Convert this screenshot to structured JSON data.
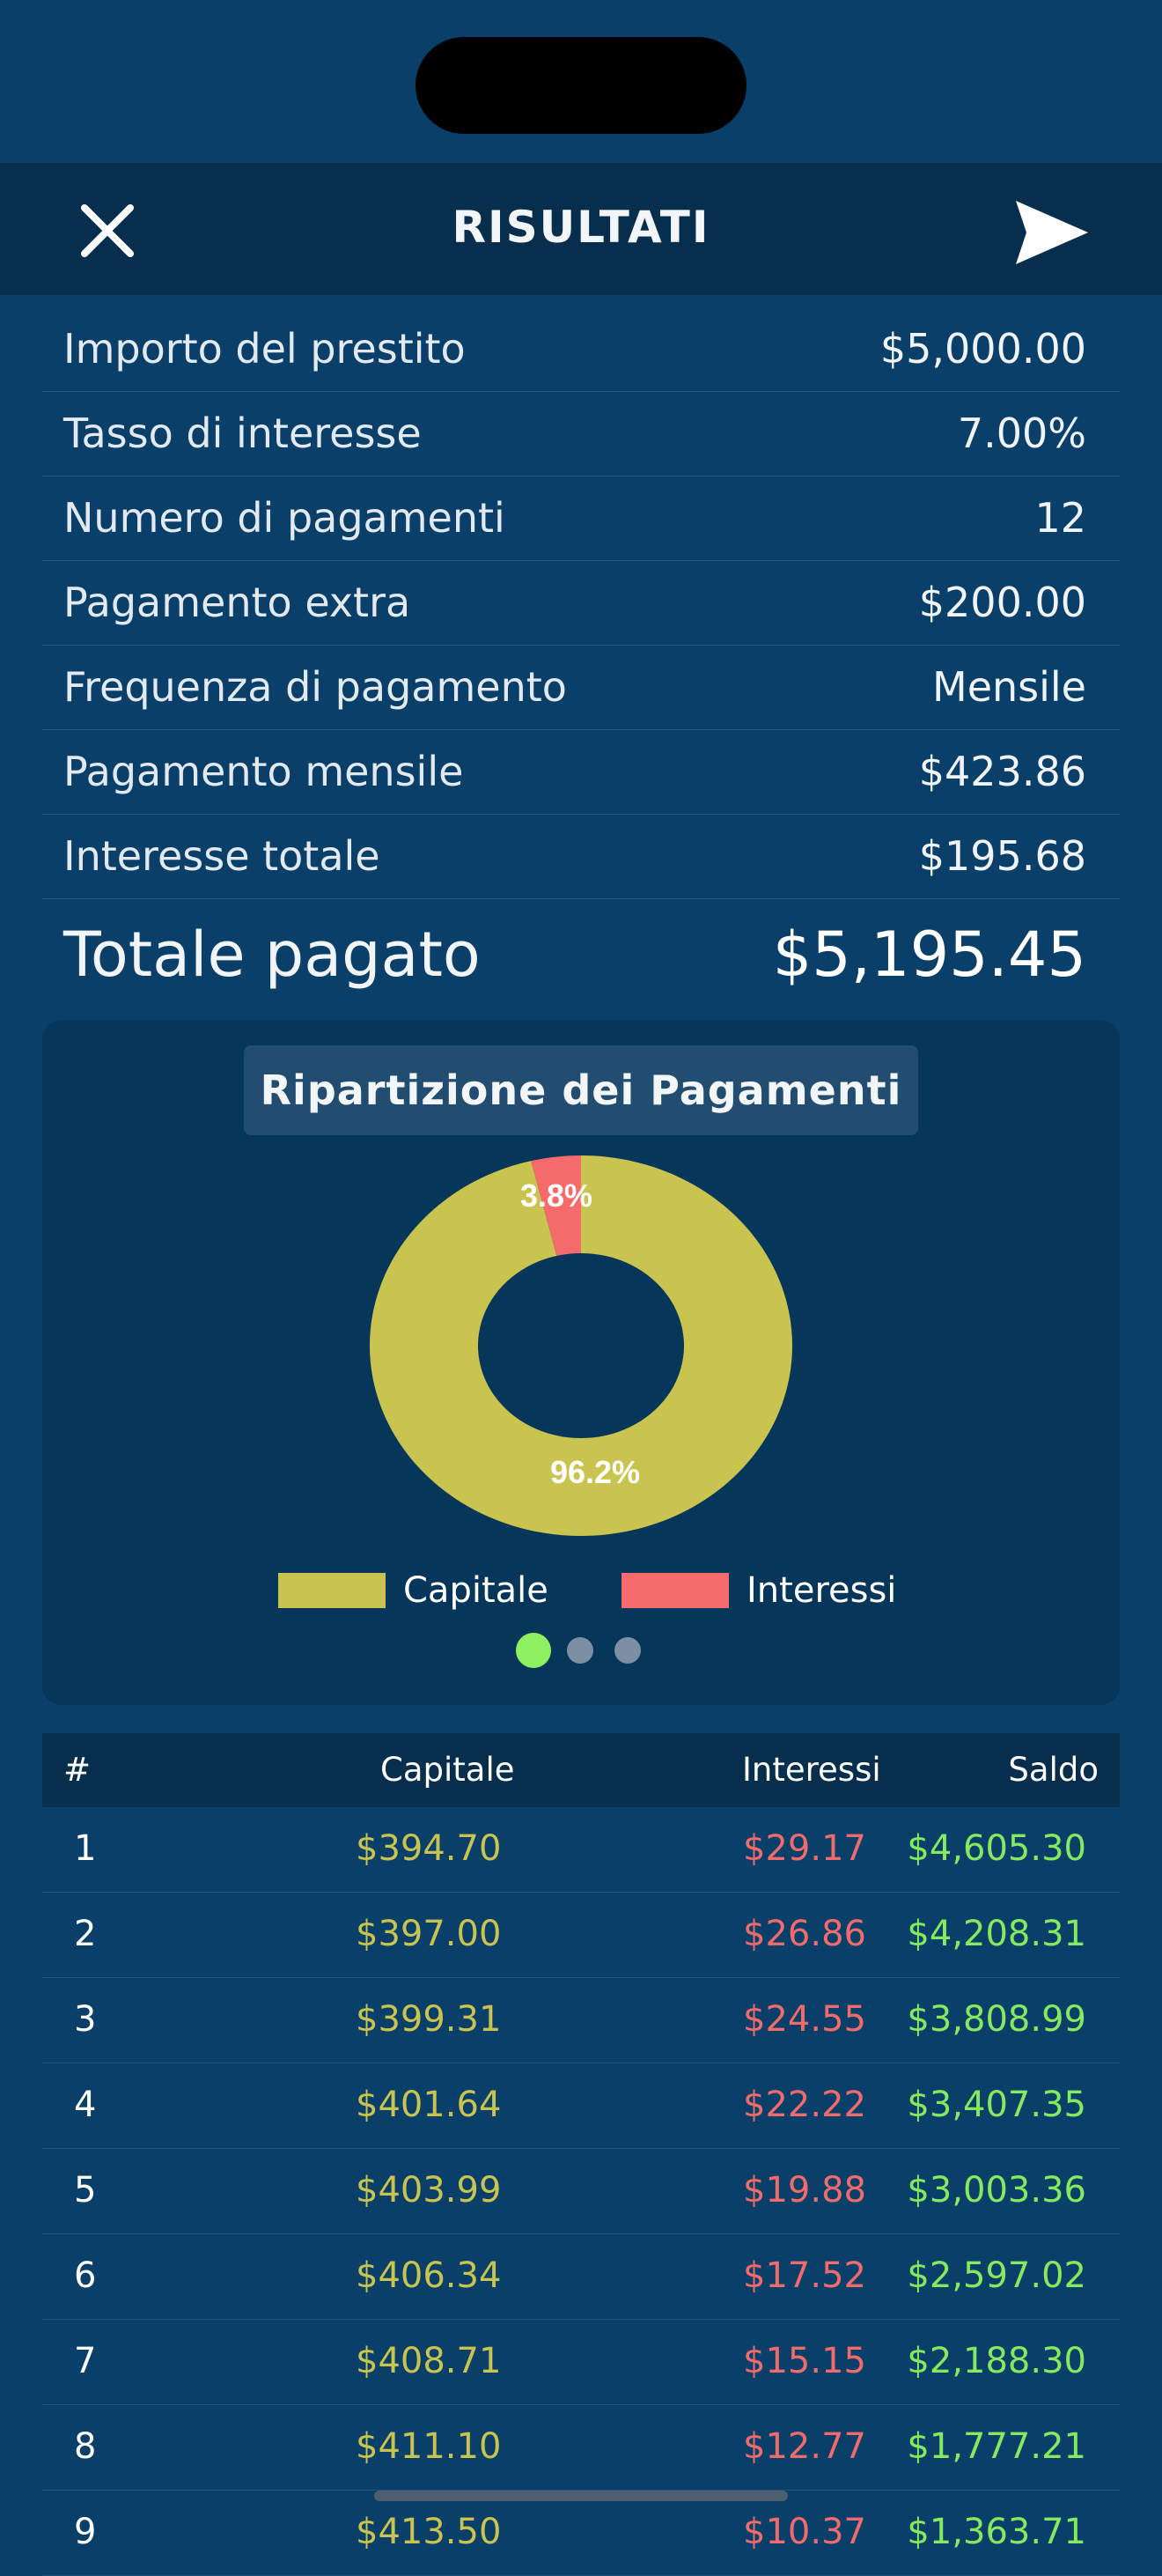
{
  "header": {
    "title": "RISULTATI",
    "close_icon": "close-icon",
    "send_icon": "send-icon"
  },
  "summary": [
    {
      "label": "Importo del prestito",
      "value": "$5,000.00"
    },
    {
      "label": "Tasso di interesse",
      "value": "7.00%"
    },
    {
      "label": "Numero di pagamenti",
      "value": "12"
    },
    {
      "label": "Pagamento extra",
      "value": "$200.00"
    },
    {
      "label": "Frequenza di pagamento",
      "value": "Mensile"
    },
    {
      "label": "Pagamento mensile",
      "value": "$423.86"
    },
    {
      "label": "Interesse totale",
      "value": "$195.68"
    }
  ],
  "total": {
    "label": "Totale pagato",
    "value": "$5,195.45"
  },
  "chart": {
    "title": "Ripartizione dei Pagamenti",
    "legend": [
      "Capitale",
      "Interessi"
    ],
    "labels": {
      "capital": "96.2%",
      "interest": "3.8%"
    },
    "colors": {
      "capital": "#c8c44f",
      "interest": "#f56a6a"
    },
    "pager": {
      "pages": 3,
      "active": 0,
      "active_color": "#8ef060",
      "inactive_color": "#7d8fa2"
    }
  },
  "chart_data": {
    "type": "pie",
    "categories": [
      "Capitale",
      "Interessi"
    ],
    "values": [
      96.2,
      3.8
    ],
    "title": "Ripartizione dei Pagamenti"
  },
  "table": {
    "headers": {
      "num": "#",
      "capital": "Capitale",
      "interest": "Interessi",
      "balance": "Saldo"
    },
    "rows": [
      {
        "num": "1",
        "capital": "$394.70",
        "interest": "$29.17",
        "balance": "$4,605.30"
      },
      {
        "num": "2",
        "capital": "$397.00",
        "interest": "$26.86",
        "balance": "$4,208.31"
      },
      {
        "num": "3",
        "capital": "$399.31",
        "interest": "$24.55",
        "balance": "$3,808.99"
      },
      {
        "num": "4",
        "capital": "$401.64",
        "interest": "$22.22",
        "balance": "$3,407.35"
      },
      {
        "num": "5",
        "capital": "$403.99",
        "interest": "$19.88",
        "balance": "$3,003.36"
      },
      {
        "num": "6",
        "capital": "$406.34",
        "interest": "$17.52",
        "balance": "$2,597.02"
      },
      {
        "num": "7",
        "capital": "$408.71",
        "interest": "$15.15",
        "balance": "$2,188.30"
      },
      {
        "num": "8",
        "capital": "$411.10",
        "interest": "$12.77",
        "balance": "$1,777.21"
      },
      {
        "num": "9",
        "capital": "$413.50",
        "interest": "$10.37",
        "balance": "$1,363.71"
      }
    ]
  }
}
